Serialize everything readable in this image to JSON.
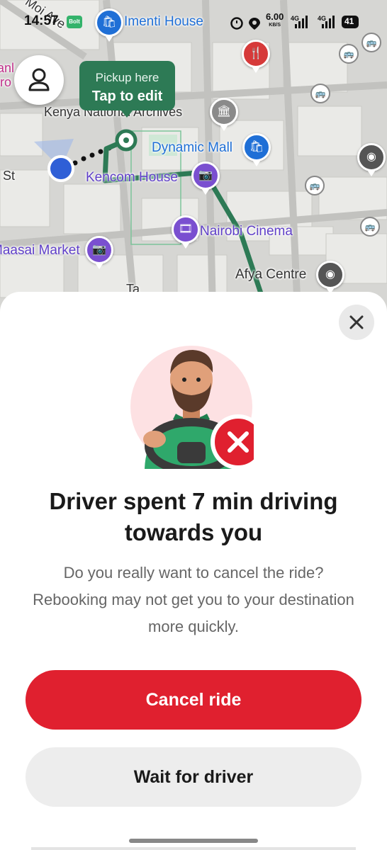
{
  "status_bar": {
    "time": "14:57",
    "app_badge": "Bolt",
    "net_speed": "6.00",
    "net_unit": "KB/S",
    "signal_1": "4G",
    "signal_2": "4G",
    "battery": "41"
  },
  "map": {
    "street_labels": [
      "Moi Ave",
      "St",
      "Ta"
    ],
    "pois": {
      "imenti_house": "Imenti House",
      "kenya_archives": "Kenya National Archives",
      "dynamic_mall": "Dynamic Mall",
      "kencom_house": "Kencom House",
      "nairobi_cinema": "Nairobi Cinema",
      "maasai_market": "Maasai Market",
      "afya_centre": "Afya Centre",
      "left_edge_text": "anl\niro"
    },
    "pickup": {
      "line1": "Pickup here",
      "line2": "Tap to edit"
    },
    "icons": [
      "profile-icon",
      "bus-stop-icon",
      "shopping-bag-icon",
      "camera-icon",
      "film-icon",
      "fork-knife-icon",
      "museum-icon"
    ]
  },
  "sheet": {
    "headline": "Driver spent 7 min driving towards you",
    "subtext": "Do you really want to cancel the ride? Rebooking may not get you to your destination more quickly.",
    "cancel_label": "Cancel ride",
    "wait_label": "Wait for driver"
  },
  "colors": {
    "primary_red": "#e0202f",
    "route_green": "#2d7a55",
    "secondary_button": "#ededed",
    "user_dot": "#2f5fd6",
    "poi_purple": "#7a4fd0",
    "poi_blue": "#1f6fd6"
  }
}
